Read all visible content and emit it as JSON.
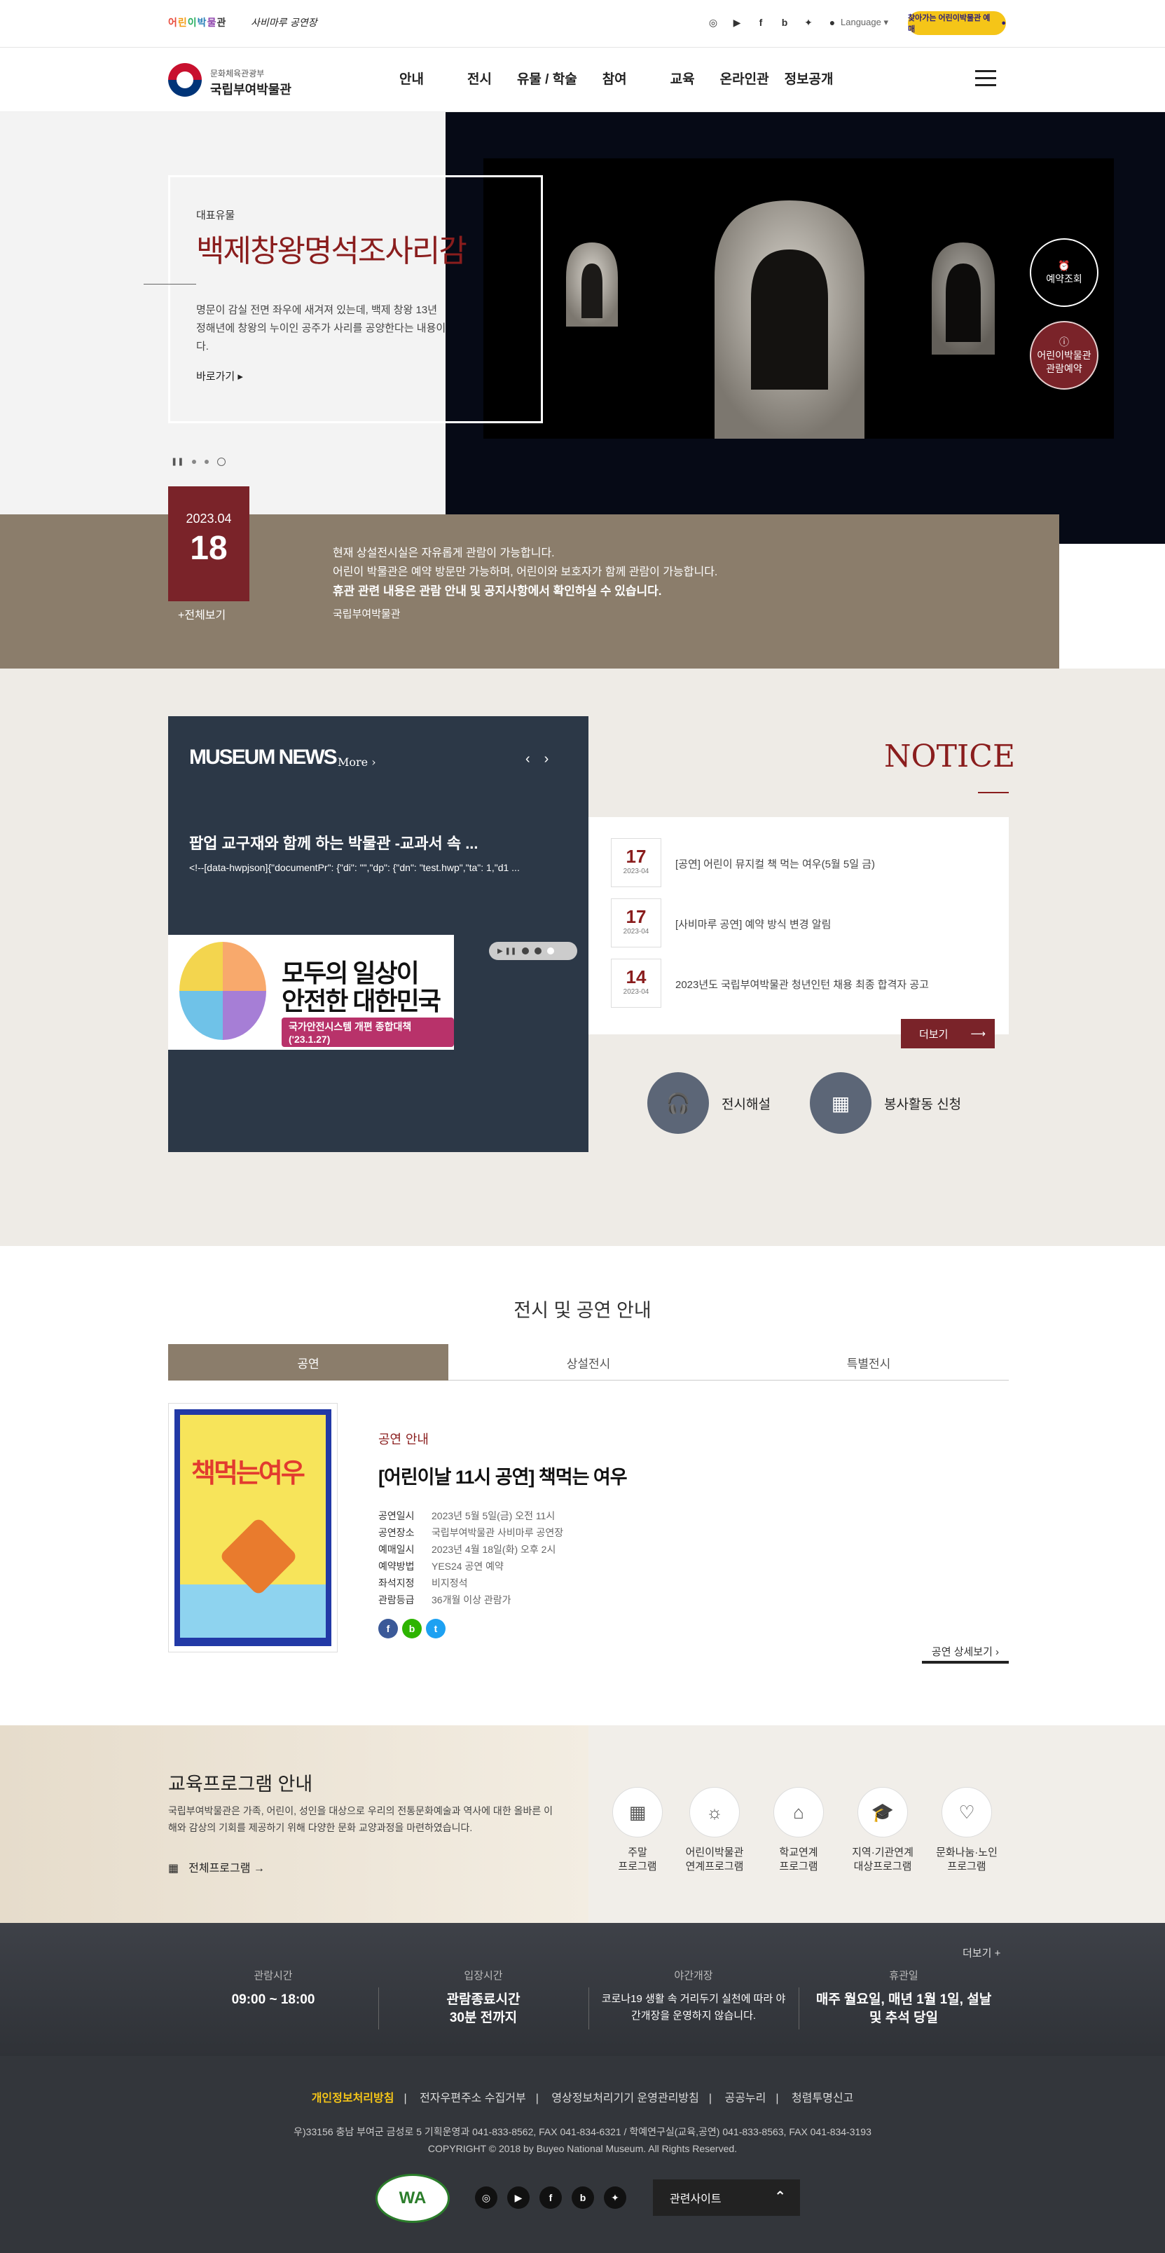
{
  "util": {
    "kids_link": "어린이박물관",
    "sabi_link": "사비마루 공연장",
    "sns": [
      "instagram-icon",
      "youtube-icon",
      "facebook-icon",
      "blog-icon",
      "twitter-icon",
      "kakao-icon"
    ],
    "language": "Language",
    "banner": "찾아가는 어린이박물관 예매"
  },
  "header": {
    "ministry": "문화체육관광부",
    "museum_name": "국립부여박물관",
    "menu": [
      "안내",
      "전시",
      "유물 / 학술",
      "참여",
      "교육",
      "온라인관",
      "정보공개"
    ]
  },
  "hero": {
    "label": "대표유물",
    "title": "백제창왕명석조사리감",
    "desc": "명문이 감실 전면 좌우에 새겨져 있는데, 백제 창왕 13년 정해년에 창왕의 누이인 공주가 사리를 공양한다는 내용이다.",
    "more": "바로가기 ▸",
    "btn_reservation": "예약조회",
    "btn_kids": "어린이박물관 관람예약"
  },
  "notice_band": {
    "year_month": "2023.04",
    "day": "18",
    "all": "+전체보기",
    "line1": "현재 상설전시실은 자유롭게 관람이 가능합니다.",
    "line2": "어린이 박물관은 예약 방문만 가능하며, 어린이와 보호자가 함께 관람이 가능합니다.",
    "line3": "휴관 관련 내용은 관람 안내 및 공지사항에서 확인하실 수 있습니다.",
    "sign": "국립부여박물관"
  },
  "news": {
    "heading": "MUSEUM NEWS",
    "more": "More ›",
    "title": "팝업 교구재와 함께 하는 박물관 -교과서 속 ...",
    "excerpt": "<!--[data-hwpjson]{\"documentPr\": {\"di\": \"\",\"dp\": {\"dn\": \"test.hwp\",\"ta\": 1,\"d1 ...",
    "banner_line1": "모두의 일상이",
    "banner_line2": "안전한 대한민국",
    "banner_tag": "국가안전시스템 개편 종합대책('23.1.27)"
  },
  "notice": {
    "heading": "NOTICE",
    "items": [
      {
        "day": "17",
        "ym": "2023-04",
        "text": "[공연] 어린이 뮤지컬 책 먹는 여우(5월 5일 금)"
      },
      {
        "day": "17",
        "ym": "2023-04",
        "text": "[사비마루 공연] 예약 방식 변경 알림"
      },
      {
        "day": "14",
        "ym": "2023-04",
        "text": "2023년도 국립부여박물관 청년인턴 채용 최종 합격자 공고"
      }
    ],
    "more": "더보기",
    "quick1": "전시해설",
    "quick2": "봉사활동 신청"
  },
  "exhibit": {
    "heading": "전시 및 공연 안내",
    "tabs": [
      "공연",
      "상설전시",
      "특별전시"
    ],
    "poster_title": "책먹는여우",
    "kind": "공연 안내",
    "title": "[어린이날 11시 공연] 책먹는 여우",
    "rows": [
      {
        "k": "공연일시",
        "v": "2023년 5월 5일(금) 오전 11시"
      },
      {
        "k": "공연장소",
        "v": "국립부여박물관 사비마루 공연장"
      },
      {
        "k": "예매일시",
        "v": "2023년 4월 18일(화) 오후 2시"
      },
      {
        "k": "예약방법",
        "v": "YES24 공연 예약"
      },
      {
        "k": "좌석지정",
        "v": "비지정석"
      },
      {
        "k": "관람등급",
        "v": "36개월 이상 관람가"
      }
    ],
    "more": "공연 상세보기 ›"
  },
  "education": {
    "heading": "교육프로그램 안내",
    "desc": "국립부여박물관은 가족, 어린이, 성인을 대상으로 우리의 전통문화예술과 역사에 대한 올바른 이해와 감상의 기회를 제공하기 위해 다양한 문화 교양과정을 마련하였습니다.",
    "all": "전체프로그램 →",
    "programs": [
      [
        "주말",
        "프로그램"
      ],
      [
        "어린이박물관",
        "연계프로그램"
      ],
      [
        "학교연계",
        "프로그램"
      ],
      [
        "지역·기관연계",
        "대상프로그램"
      ],
      [
        "문화나눔·노인",
        "프로그램"
      ]
    ]
  },
  "hours": {
    "more": "더보기 +",
    "c1_label": "관람시간",
    "c1_value": "09:00 ~ 18:00",
    "c2_label": "입장시간",
    "c2_value": "관람종료시간 30분 전까지",
    "c3_label": "야간개장",
    "c3_value": "코로나19 생활 속 거리두기 실천에 따라 야간개장을 운영하지 않습니다.",
    "c4_label": "휴관일",
    "c4_value": "매주 월요일, 매년 1월 1일, 설날 및 추석 당일"
  },
  "footer": {
    "links": [
      "개인정보처리방침",
      "전자우편주소 수집거부",
      "영상정보처리기기 운영관리방침",
      "공공누리",
      "청렴투명신고"
    ],
    "address": "우)33156 충남 부여군 금성로 5 기획운영과 041-833-8562, FAX 041-834-6321 / 학예연구실(교육,공연) 041-833-8563, FAX 041-834-3193",
    "copyright": "COPYRIGHT © 2018 by Buyeo National Museum. All Rights Reserved.",
    "wa_mark": "WA",
    "related": "관련사이트"
  }
}
